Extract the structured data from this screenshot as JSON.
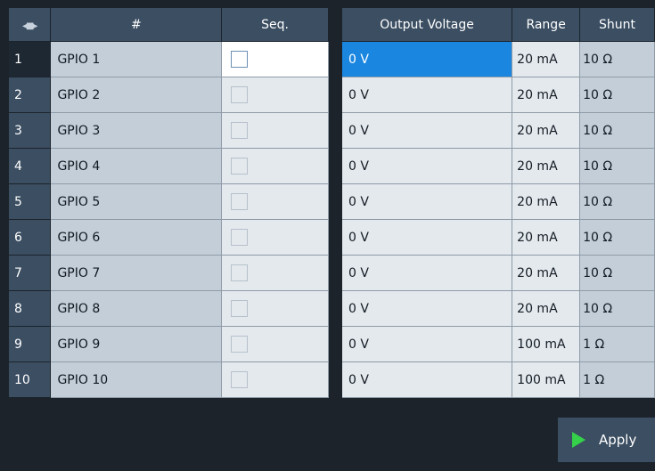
{
  "left_table": {
    "columns": [
      {
        "label": "",
        "icon": "column-resize-icon"
      },
      {
        "label": "#"
      },
      {
        "label": "Seq."
      }
    ]
  },
  "right_table": {
    "columns": [
      {
        "label": "Output Voltage"
      },
      {
        "label": "Range"
      },
      {
        "label": "Shunt"
      }
    ]
  },
  "rows": [
    {
      "num": "1",
      "name": "GPIO 1",
      "seq_checked": false,
      "voltage": "0 V",
      "range": "20 mA",
      "shunt": "10 Ω"
    },
    {
      "num": "2",
      "name": "GPIO 2",
      "seq_checked": false,
      "voltage": "0 V",
      "range": "20 mA",
      "shunt": "10 Ω"
    },
    {
      "num": "3",
      "name": "GPIO 3",
      "seq_checked": false,
      "voltage": "0 V",
      "range": "20 mA",
      "shunt": "10 Ω"
    },
    {
      "num": "4",
      "name": "GPIO 4",
      "seq_checked": false,
      "voltage": "0 V",
      "range": "20 mA",
      "shunt": "10 Ω"
    },
    {
      "num": "5",
      "name": "GPIO 5",
      "seq_checked": false,
      "voltage": "0 V",
      "range": "20 mA",
      "shunt": "10 Ω"
    },
    {
      "num": "6",
      "name": "GPIO 6",
      "seq_checked": false,
      "voltage": "0 V",
      "range": "20 mA",
      "shunt": "10 Ω"
    },
    {
      "num": "7",
      "name": "GPIO 7",
      "seq_checked": false,
      "voltage": "0 V",
      "range": "20 mA",
      "shunt": "10 Ω"
    },
    {
      "num": "8",
      "name": "GPIO 8",
      "seq_checked": false,
      "voltage": "0 V",
      "range": "20 mA",
      "shunt": "10 Ω"
    },
    {
      "num": "9",
      "name": "GPIO 9",
      "seq_checked": false,
      "voltage": "0 V",
      "range": "100 mA",
      "shunt": "1 Ω"
    },
    {
      "num": "10",
      "name": "GPIO 10",
      "seq_checked": false,
      "voltage": "0 V",
      "range": "100 mA",
      "shunt": "1 Ω"
    }
  ],
  "selected_row": 1,
  "apply_button": {
    "label": "Apply",
    "icon": "play-icon"
  },
  "colors": {
    "background": "#1c232b",
    "header": "#3b4e62",
    "selection": "#1a86e0",
    "name_cell": "#c4ced8",
    "value_cell": "#e4e9ee",
    "apply_icon": "#35d14a"
  }
}
